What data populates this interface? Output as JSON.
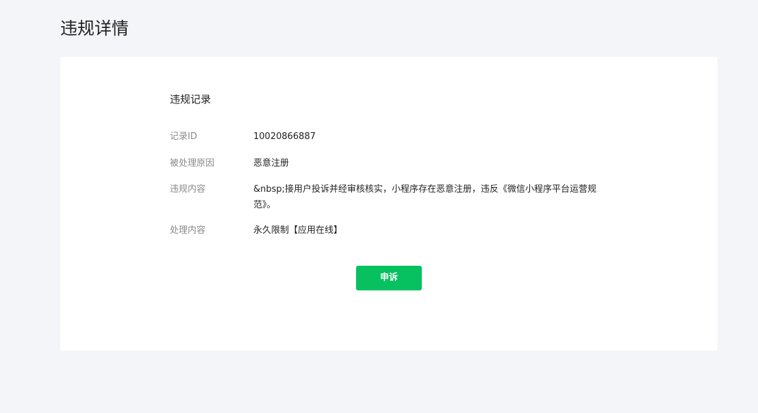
{
  "header": {
    "title": "违规详情"
  },
  "record": {
    "section_title": "违规记录",
    "fields": [
      {
        "label": "记录ID",
        "value": "10020866887"
      },
      {
        "label": "被处理原因",
        "value": "恶意注册"
      },
      {
        "label": "违规内容",
        "value": "&nbsp;接用户投诉并经审核核实，小程序存在恶意注册，违反《微信小程序平台运营规范》。"
      },
      {
        "label": "处理内容",
        "value": "永久限制【应用在线】"
      }
    ],
    "appeal_button_label": "申诉"
  },
  "colors": {
    "background": "#f4f5f8",
    "card": "#ffffff",
    "accent": "#07c160",
    "label": "#8a8a8a"
  }
}
